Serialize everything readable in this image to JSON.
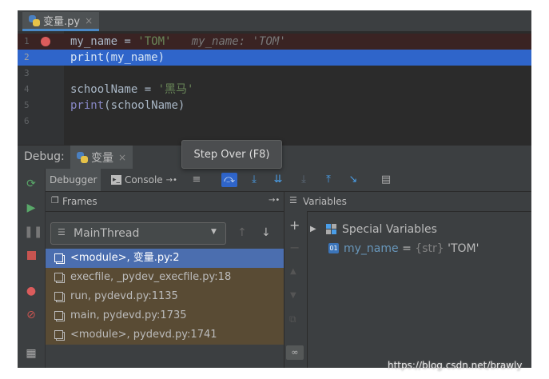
{
  "editor": {
    "tab_label": "变量.py",
    "lines": [
      {
        "num": "1",
        "parts": [
          {
            "t": "my_name = ",
            "c": "plain"
          },
          {
            "t": "'TOM'",
            "c": "string"
          },
          {
            "t": "   my_name: 'TOM'",
            "c": "hint"
          }
        ]
      },
      {
        "num": "2",
        "parts": [
          {
            "t": "print",
            "c": "builtin"
          },
          {
            "t": "(my_name)",
            "c": "plain"
          }
        ]
      },
      {
        "num": "3",
        "parts": []
      },
      {
        "num": "4",
        "parts": [
          {
            "t": "schoolName = ",
            "c": "plain"
          },
          {
            "t": "'黑马'",
            "c": "string"
          }
        ]
      },
      {
        "num": "5",
        "parts": [
          {
            "t": "print",
            "c": "builtin"
          },
          {
            "t": "(schoolName)",
            "c": "plain"
          }
        ]
      },
      {
        "num": "6",
        "parts": []
      }
    ]
  },
  "debug": {
    "title": "Debug:",
    "session_tab": "变量",
    "tooltip": "Step Over (F8)",
    "tabs": {
      "debugger": "Debugger",
      "console": "Console"
    },
    "frames_header": "Frames",
    "variables_header": "Variables",
    "thread": "MainThread",
    "frames": [
      {
        "label": "<module>, 变量.py:2",
        "state": "selected"
      },
      {
        "label": "execfile, _pydev_execfile.py:18",
        "state": "library"
      },
      {
        "label": "run, pydevd.py:1135",
        "state": "library"
      },
      {
        "label": "main, pydevd.py:1735",
        "state": "library"
      },
      {
        "label": "<module>, pydevd.py:1741",
        "state": "library"
      }
    ],
    "variables": [
      {
        "name": "Special Variables"
      },
      {
        "name": "my_name",
        "eq": " = ",
        "type": "{str}",
        "value": " 'TOM'"
      }
    ]
  },
  "watermark": "https://blog.csdn.net/brawly",
  "colors": {
    "selection": "#2f65ca",
    "library_frame": "#594b34",
    "breakpoint": "#db5c5c"
  }
}
